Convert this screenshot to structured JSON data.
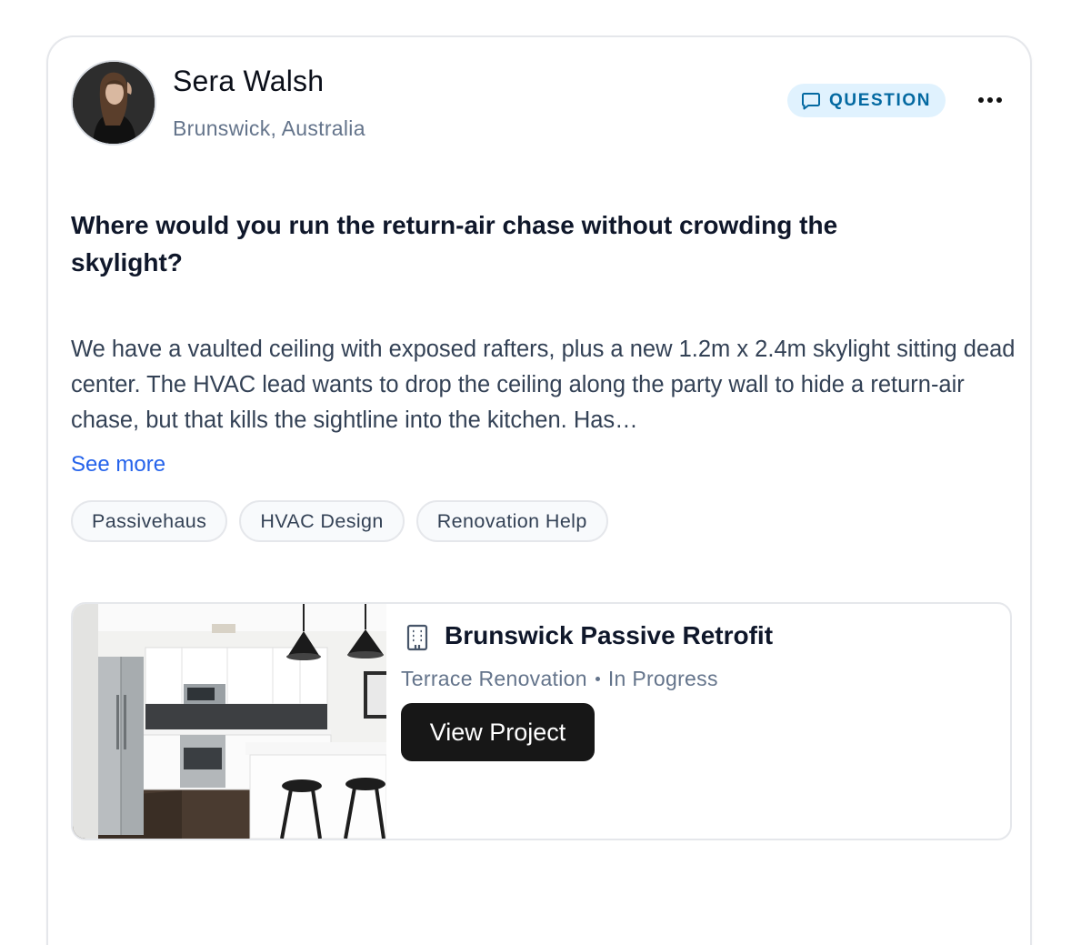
{
  "post": {
    "author": {
      "name": "Sera Walsh",
      "location": "Brunswick, Australia"
    },
    "badge": {
      "label": "QUESTION",
      "icon": "chat-bubble-icon",
      "color": "#0369a1",
      "background": "#e0f2fe"
    },
    "menu_icon": "more-horizontal-icon",
    "title": "Where would you run the return-air chase without crowding the skylight?",
    "body": "We have a vaulted ceiling with exposed rafters, plus a new 1.2m x 2.4m skylight sitting dead center. The HVAC lead wants to drop the ceiling along the party wall to hide a return-air chase, but that kills the sightline into the kitchen. Has…",
    "see_more": "See more",
    "tags": [
      "Passivehaus",
      "HVAC Design",
      "Renovation Help"
    ]
  },
  "project": {
    "icon": "building-icon",
    "name": "Brunswick Passive Retrofit",
    "type": "Terrace Renovation",
    "status": "In Progress",
    "button_label": "View Project"
  },
  "colors": {
    "link": "#2563eb",
    "button": "#171717"
  }
}
